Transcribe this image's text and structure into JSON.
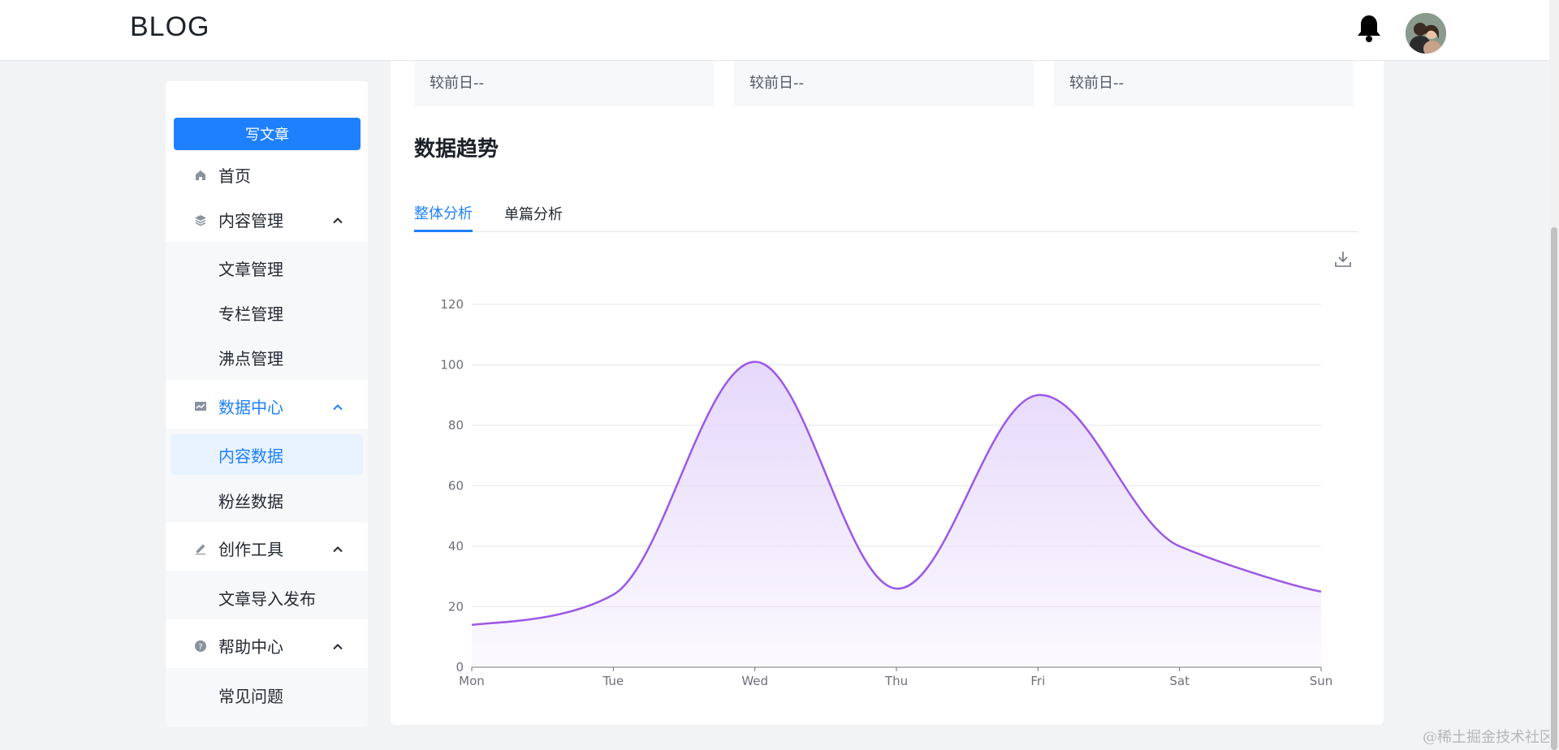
{
  "header": {
    "logo": "BLOG",
    "bell_icon": "bell-icon",
    "avatar_alt": "user-avatar"
  },
  "sidebar": {
    "write_button": "写文章",
    "items": [
      {
        "label": "首页",
        "icon": "home-icon"
      },
      {
        "label": "内容管理",
        "icon": "layers-icon",
        "expanded": true,
        "children": [
          "文章管理",
          "专栏管理",
          "沸点管理"
        ]
      },
      {
        "label": "数据中心",
        "icon": "chart-icon",
        "expanded": true,
        "active": true,
        "children": [
          "内容数据",
          "粉丝数据"
        ],
        "selected_child": "内容数据"
      },
      {
        "label": "创作工具",
        "icon": "pen-icon",
        "expanded": true,
        "children": [
          "文章导入发布"
        ]
      },
      {
        "label": "帮助中心",
        "icon": "help-icon",
        "expanded": true,
        "children": [
          "常见问题"
        ]
      }
    ]
  },
  "main": {
    "stat_cards": [
      "较前日--",
      "较前日--",
      "较前日--"
    ],
    "section_title": "数据趋势",
    "tabs": [
      {
        "label": "整体分析",
        "active": true
      },
      {
        "label": "单篇分析",
        "active": false
      }
    ],
    "download_icon": "download-icon"
  },
  "chart_data": {
    "type": "area",
    "categories": [
      "Mon",
      "Tue",
      "Wed",
      "Thu",
      "Fri",
      "Sat",
      "Sun"
    ],
    "series": [
      {
        "values": [
          14,
          24,
          101,
          26,
          90,
          40,
          25
        ]
      }
    ],
    "ylim": [
      0,
      120
    ],
    "yticks": [
      0,
      20,
      40,
      60,
      80,
      100,
      120
    ],
    "grid": true,
    "line_color": "#9b59e6",
    "fill_color": "#e6d8fb",
    "smooth": true
  },
  "watermark": "@稀土掘金技术社区",
  "colors": {
    "accent": "#1e80ff",
    "background": "#f2f3f5"
  }
}
